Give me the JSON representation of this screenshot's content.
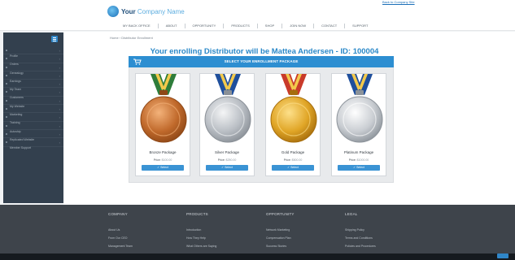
{
  "header": {
    "logo_bold": "Your",
    "logo_light": "Company Name",
    "top_link": "Back to Company Site"
  },
  "nav": {
    "items": [
      "MY BACK OFFICE",
      "ABOUT",
      "OPPORTUNITY",
      "PRODUCTS",
      "SHOP",
      "JOIN NOW",
      "CONTACT",
      "SUPPORT"
    ]
  },
  "sidebar": {
    "items": [
      "Profile",
      "Orders",
      "Genealogy",
      "Earnings",
      "My Team",
      "Customers",
      "My Website",
      "Marketing",
      "Training",
      "Autoship",
      "Replicated Website",
      "Member Support"
    ]
  },
  "breadcrumb": "Home › Distributor Enrollment",
  "page": {
    "title": "Your enrolling Distributor will be Mattea Andersen - ID: 100004",
    "panel_title": "SELECT YOUR ENROLLMENT PACKAGE"
  },
  "packages": [
    {
      "name": "Bronze Package",
      "price_label": "Price:",
      "price": "$100.00",
      "button": "Select"
    },
    {
      "name": "Silver Package",
      "price_label": "Price:",
      "price": "$250.00",
      "button": "Select"
    },
    {
      "name": "Gold Package",
      "price_label": "Price:",
      "price": "$500.00",
      "button": "Select"
    },
    {
      "name": "Platinum Package",
      "price_label": "Price:",
      "price": "$1000.00",
      "button": "Select"
    }
  ],
  "footer": {
    "columns": [
      {
        "heading": "COMPANY",
        "links": [
          "About Us",
          "From Our CEO",
          "Management Team"
        ]
      },
      {
        "heading": "PRODUCTS",
        "links": [
          "Introduction",
          "How They Help",
          "What Others are Saying"
        ]
      },
      {
        "heading": "OPPORTUNITY",
        "links": [
          "Network Marketing",
          "Compensation Plan",
          "Success Stories"
        ]
      },
      {
        "heading": "LEGAL",
        "links": [
          "Shipping Policy",
          "Terms and Conditions",
          "Policies and Procedures"
        ]
      }
    ]
  },
  "colors": {
    "accent": "#2d8ed1",
    "title": "#2a88c8",
    "sidebar": "#33404e",
    "footer": "#3e444b"
  },
  "icons": {
    "logo": "globe-icon",
    "cart": "shopping-cart-icon",
    "menu": "hamburger-icon",
    "select": "check-icon"
  }
}
